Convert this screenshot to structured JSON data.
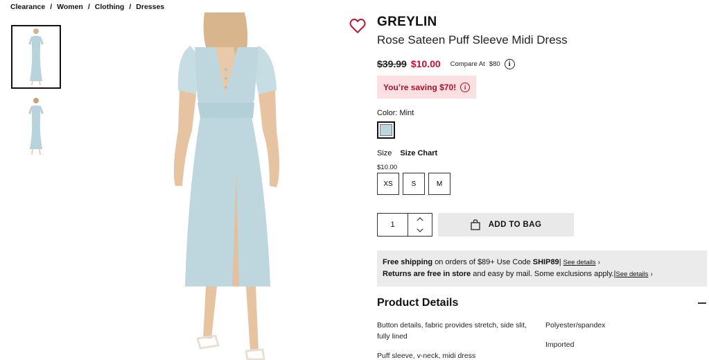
{
  "breadcrumb": [
    "Clearance",
    "Women",
    "Clothing",
    "Dresses"
  ],
  "breadcrumb_separator": "/",
  "product": {
    "brand": "GREYLIN",
    "title": "Rose Sateen Puff Sleeve Midi Dress",
    "original_price": "$39.99",
    "sale_price": "$10.00",
    "compare_label": "Compare At",
    "compare_value": "$80",
    "saving_text": "You’re saving $70!",
    "color_label": "Color:",
    "color_value": "Mint",
    "size_label": "Size",
    "size_chart_label": "Size Chart",
    "size_price": "$10.00",
    "sizes": [
      "XS",
      "S",
      "M"
    ],
    "quantity": "1",
    "add_to_bag_label": "ADD TO BAG"
  },
  "shipping": {
    "line1_bold": "Free shipping",
    "line1_text": "on orders of $89+ Use Code",
    "line1_code": "SHIP89",
    "line1_link": "See details",
    "line2_bold": "Returns are free in store",
    "line2_text": "and easy by mail. Some exclusions apply.",
    "line2_link": "See details"
  },
  "details": {
    "heading": "Product Details",
    "col1": [
      "Button details, fabric provides stretch, side slit, fully lined",
      "Puff sleeve, v-neck, midi dress"
    ],
    "col2": [
      "Polyester/spandex",
      "Imported"
    ]
  },
  "icons": {
    "heart": "heart-outline-icon",
    "info": "info-icon",
    "bag": "shopping-bag-icon",
    "chevron": "chevron-right-icon"
  },
  "colors": {
    "sale_red": "#c8102e",
    "saving_bg": "#fbdfe1",
    "swatch_mint": "#bcd6de",
    "button_bg": "#e9e9e9",
    "shipping_bg": "#ebebeb"
  }
}
